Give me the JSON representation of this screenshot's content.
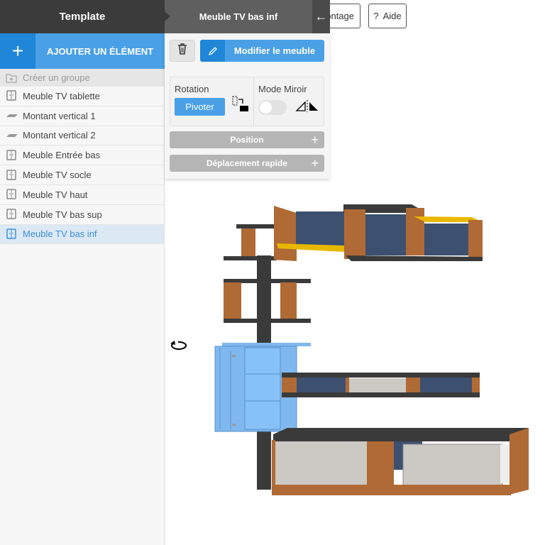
{
  "header": {
    "title": "Template",
    "selected_title": "Meuble TV bas inf",
    "back_icon": "arrow-left-icon"
  },
  "toolbar": {
    "montage_label": "Montage",
    "help_label": "Aide",
    "help_icon": "?"
  },
  "sidebar": {
    "add_label": "AJOUTER UN ÉLÉMENT",
    "create_group": "Créer un groupe",
    "items": [
      {
        "label": "Meuble TV tablette",
        "icon": "cabinet-icon"
      },
      {
        "label": "Montant vertical 1",
        "icon": "panel-icon"
      },
      {
        "label": "Montant vertical 2",
        "icon": "panel-icon"
      },
      {
        "label": "Meuble Entrée bas",
        "icon": "cabinet-icon"
      },
      {
        "label": "Meuble TV socle",
        "icon": "cabinet-icon"
      },
      {
        "label": "Meuble TV haut",
        "icon": "cabinet-icon"
      },
      {
        "label": "Meuble TV bas sup",
        "icon": "cabinet-icon"
      },
      {
        "label": "Meuble TV bas inf",
        "icon": "cabinet-icon",
        "selected": true
      }
    ]
  },
  "panel": {
    "edit_label": "Modifier le meuble",
    "rotation_label": "Rotation",
    "rotate_button": "Pivoter",
    "mirror_label": "Mode Miroir",
    "mirror_on": false,
    "position_label": "Position",
    "quick_move_label": "Déplacement rapide"
  },
  "colors": {
    "accent": "#4aa0e6",
    "accent_dark": "#1f86d8",
    "selected": "#7fb8ee",
    "wood": "#b06a35",
    "dark": "#3a3a3a",
    "blue_back": "#3d5070",
    "yellow": "#e8b800"
  }
}
